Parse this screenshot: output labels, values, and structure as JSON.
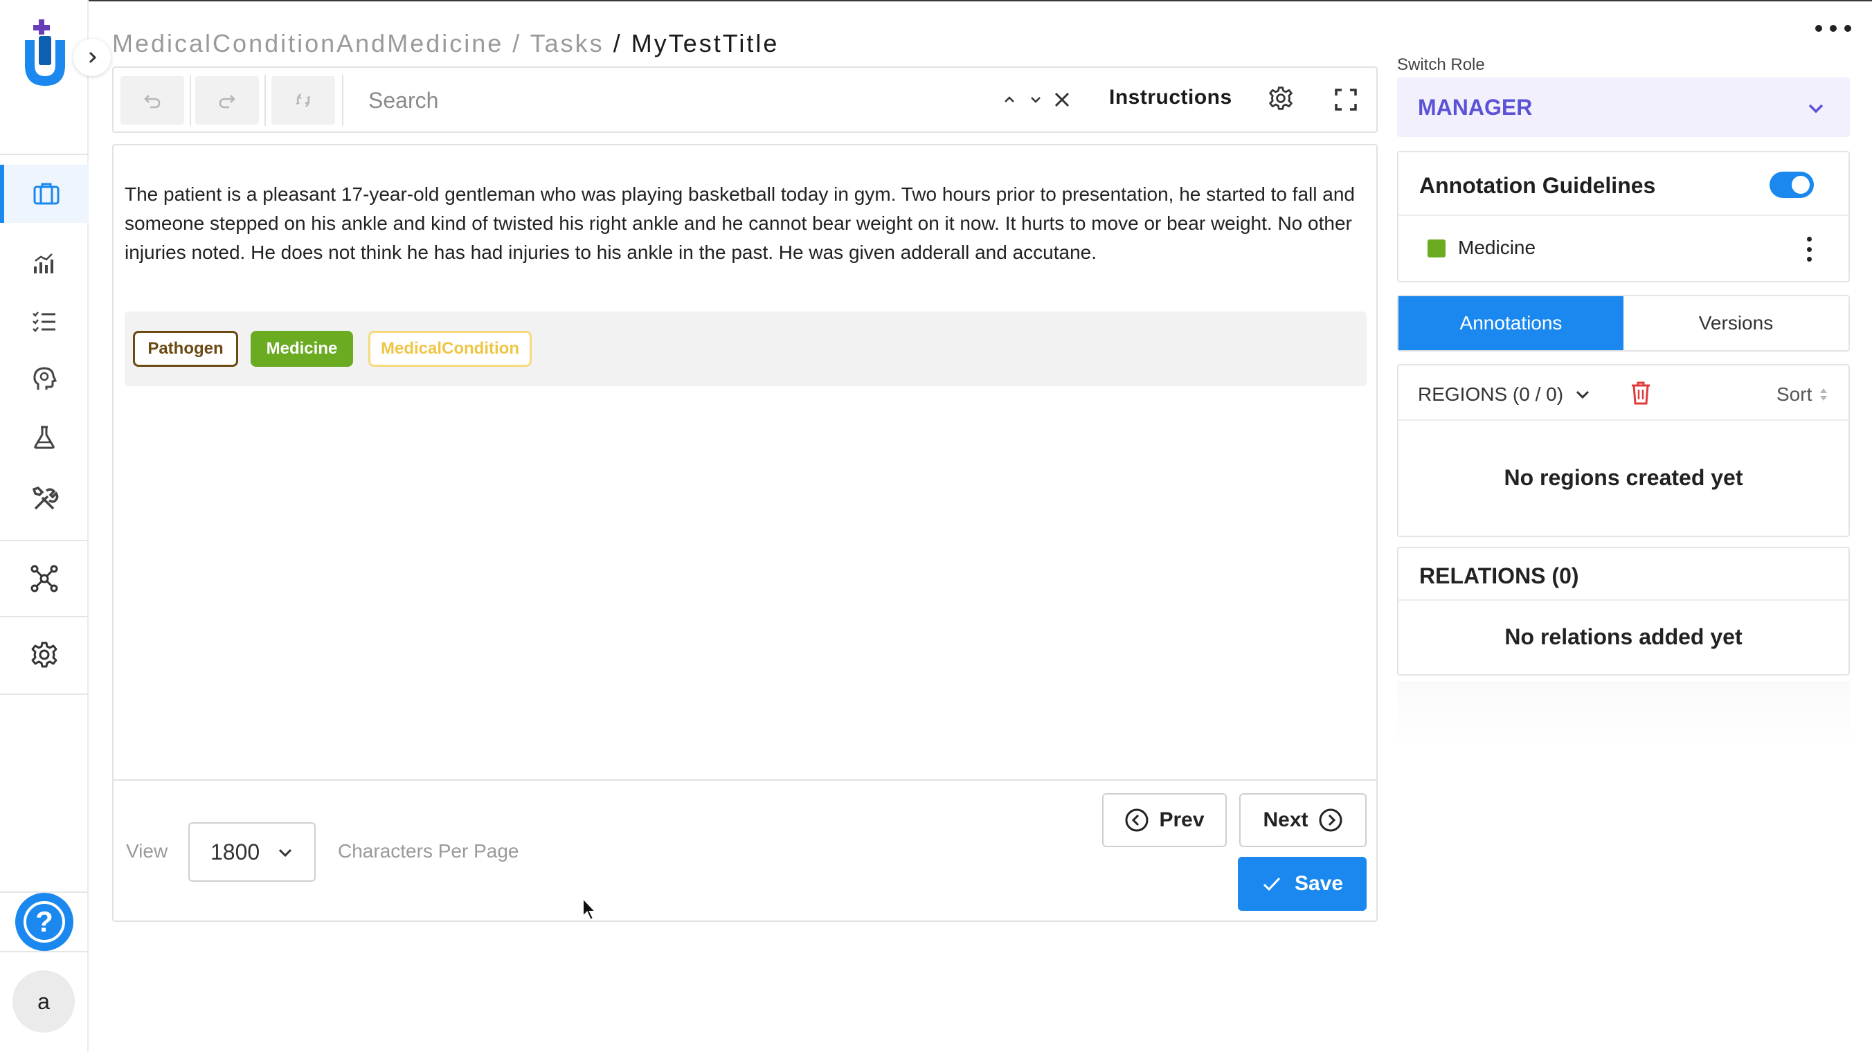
{
  "breadcrumb": {
    "project": "MedicalConditionAndMedicine",
    "section": "Tasks",
    "current": "MyTestTitle"
  },
  "toolbar": {
    "search_placeholder": "Search",
    "instructions_label": "Instructions"
  },
  "document": {
    "text": "The patient is a pleasant 17-year-old gentleman who was playing basketball today in gym. Two hours prior to presentation, he started to fall and someone stepped on his ankle and kind of twisted his right ankle and he cannot bear weight on it now. It hurts to move or bear weight. No other injuries noted. He does not think he has had injuries to his ankle in the past. He was given adderall and accutane."
  },
  "labels": [
    {
      "name": "Pathogen",
      "color": "#6b4a14"
    },
    {
      "name": "Medicine",
      "color": "#6aab22"
    },
    {
      "name": "MedicalCondition",
      "color": "#efc545"
    }
  ],
  "footer": {
    "view_label": "View",
    "chars_per_page": "1800",
    "chars_per_page_label": "Characters Per Page",
    "prev_label": "Prev",
    "next_label": "Next",
    "save_label": "Save"
  },
  "sidebar": {
    "avatar_initial": "a",
    "help_glyph": "?"
  },
  "right_panel": {
    "switch_role_label": "Switch Role",
    "role": "MANAGER",
    "guidelines": {
      "title": "Annotation Guidelines",
      "enabled": true,
      "label_name": "Medicine",
      "label_color": "#6aab22"
    },
    "tabs": [
      {
        "label": "Annotations",
        "active": true
      },
      {
        "label": "Versions",
        "active": false
      }
    ],
    "regions": {
      "title": "REGIONS (0 / 0)",
      "sort_label": "Sort",
      "empty_message": "No regions created yet"
    },
    "relations": {
      "title": "RELATIONS (0)",
      "empty_message": "No relations added yet"
    }
  },
  "colors": {
    "accent": "#1a88ee",
    "role_text": "#5c52d6",
    "danger": "#e03a3a"
  }
}
